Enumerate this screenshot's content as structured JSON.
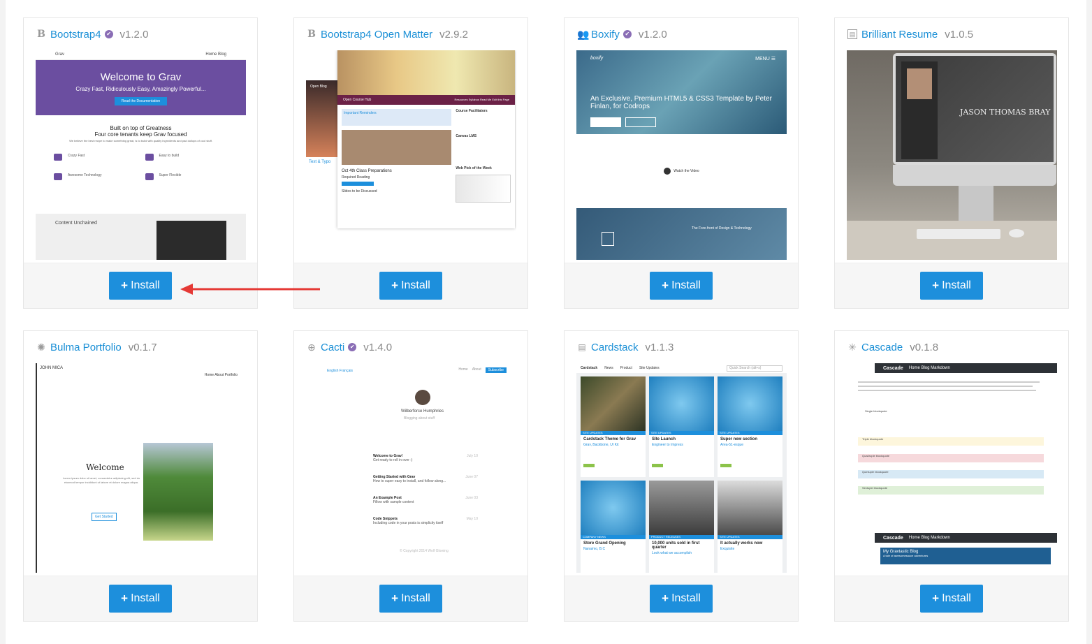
{
  "cards": [
    {
      "name": "Bootstrap4",
      "version": "v1.2.0",
      "icon": "bootstrap-icon",
      "verified": true,
      "install_label": "Install"
    },
    {
      "name": "Bootstrap4 Open Matter",
      "version": "v2.9.2",
      "icon": "bootstrap-icon",
      "verified": false,
      "install_label": "Install"
    },
    {
      "name": "Boxify",
      "version": "v1.2.0",
      "icon": "users-icon",
      "verified": true,
      "install_label": "Install"
    },
    {
      "name": "Brilliant Resume",
      "version": "v1.0.5",
      "icon": "id-card-icon",
      "verified": false,
      "install_label": "Install"
    },
    {
      "name": "Bulma Portfolio",
      "version": "v0.1.7",
      "icon": "rebel-icon",
      "verified": false,
      "install_label": "Install"
    },
    {
      "name": "Cacti",
      "version": "v1.4.0",
      "icon": "globe-icon",
      "verified": true,
      "install_label": "Install"
    },
    {
      "name": "Cardstack",
      "version": "v1.1.3",
      "icon": "list-icon",
      "verified": false,
      "install_label": "Install"
    },
    {
      "name": "Cascade",
      "version": "v0.1.8",
      "icon": "asterisk-icon",
      "verified": false,
      "install_label": "Install"
    }
  ],
  "thumbs": {
    "bootstrap4": {
      "nav_logo": "Grav",
      "nav_links": "Home  Blog",
      "hero_title": "Welcome to Grav",
      "hero_sub": "Crazy Fast, Ridiculously Easy, Amazingly Powerful...",
      "hero_btn": "Read the Documentation",
      "section_title": "Built on top of Greatness",
      "section_sub": "Four core tenants keep Grav focused",
      "section_desc": "We believe the best recipe to make something great, is to build with quality ingredients and pad dollops of cool stuff.",
      "features": [
        "Crazy Fast",
        "Easy to build",
        "Awesome Technology",
        "Super Flexible"
      ],
      "bottom_title": "Content Unchained"
    },
    "openmatter": {
      "back_label": "Open Blog",
      "bar_title": "Open Course Hub",
      "bar_links": "Resources  Syllabus  Read Me  Edit this Page",
      "reminder_title": "Important Reminders",
      "facilitators": "Course Facilitators",
      "canvas": "Canvas LMS",
      "prep": "Oct 4th Class Preparations",
      "reading": "Required Reading",
      "discussed": "Slides to be Discussed",
      "web_pick": "Web Pick of the Week",
      "text_typo": "Text & Typo"
    },
    "boxify": {
      "logo": "boxify",
      "menu": "MENU ☰",
      "headline": "An Exclusive, Premium HTML5 & CSS3 Template by Peter Finlan, for Codrops",
      "video": "Watch the Video",
      "bottom": "The Fore-front of Design & Technology"
    },
    "resume": {
      "name": "JASON THOMAS BRAY"
    },
    "bulma": {
      "logo": "JOHN MICA",
      "nav": "Home   About   Portfolio",
      "welcome": "Welcome",
      "para": "Lorem ipsum dolor sit amet, consectetur adipiscing elit, sed do eiusmod tempor incididunt ut labore et dolore magna aliqua.",
      "btn": "Get Started"
    },
    "cacti": {
      "nav": "English  Français",
      "links": [
        "Home",
        "About"
      ],
      "subscribe": "Subscribe",
      "author": "Wilberforce Humphries",
      "tagline": "Blogging about stuff",
      "posts": [
        {
          "title": "Welcome to Grav!",
          "desc": "Get ready to roll in over :)",
          "date": "July 10"
        },
        {
          "title": "Getting Started with Grav",
          "desc": "How to super easy to install, and follow along...",
          "date": "June 07"
        },
        {
          "title": "An Example Post",
          "desc": "Fillow with sample content",
          "date": "June 03"
        },
        {
          "title": "Code Snippets",
          "desc": "Including code in your posts is simplicity itself",
          "date": "May 10"
        }
      ],
      "footer": "© Copyright 2014 Wolf Glowing"
    },
    "cardstack": {
      "brand": "Cardstack",
      "news": "News",
      "product": "Product",
      "site_updates": "Site Updates",
      "search": "Quick Search (alt+s)",
      "cards": [
        {
          "label": "SITE UPDATES",
          "title": "Cardstack Theme for Grav",
          "sub": "Grav, Backbone, UI Kit"
        },
        {
          "label": "SITE UPDATES",
          "title": "Site Launch",
          "sub": "Engineer to Impress"
        },
        {
          "label": "SITE UPDATES",
          "title": "Super new section",
          "sub": "Area-51-esque"
        },
        {
          "label": "COMPANY NEWS",
          "title": "Store Grand Opening",
          "sub": "Nanaimo, B.C"
        },
        {
          "label": "PRODUCT RELEASES",
          "title": "10,000 units sold in first quarter",
          "sub": "Look what we accomplish"
        },
        {
          "label": "SITE UPDATES",
          "title": "It actually works now",
          "sub": "Exquisite"
        }
      ]
    },
    "cascade": {
      "brand": "Cascade",
      "nav": "Home  Blog  Markdown",
      "single": "Single blockquote",
      "triple": "Triple blockquote",
      "quadruple": "Quadruple blockquote",
      "quintuple": "Quintuple blockquote",
      "sextuple": "Sextuple blockquote",
      "blog_title": "My Gravtastic Blog",
      "blog_sub": "A tale of awesomesauce adventures"
    }
  },
  "colors": {
    "link": "#1a8fd6",
    "button": "#1d8fdc",
    "arrow": "#e53935",
    "verified_badge": "#8a6db5"
  }
}
